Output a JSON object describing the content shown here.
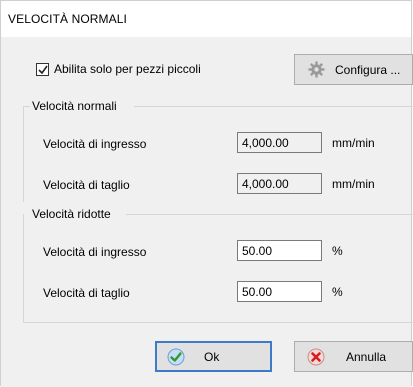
{
  "dialog": {
    "title": "VELOCITÀ NORMALI",
    "enable_checkbox": {
      "label": "Abilita solo per pezzi piccoli",
      "checked": true
    },
    "configure_button": {
      "label": "Configura ...",
      "icon": "gear-icon"
    },
    "normal_group": {
      "title": "Velocità normali",
      "rows": [
        {
          "label": "Velocità di ingresso",
          "value": "4,000.00",
          "unit": "mm/min"
        },
        {
          "label": "Velocità di taglio",
          "value": "4,000.00",
          "unit": "mm/min"
        }
      ]
    },
    "reduced_group": {
      "title": "Velocità ridotte",
      "rows": [
        {
          "label": "Velocità di ingresso",
          "value": "50.00",
          "unit": "%"
        },
        {
          "label": "Velocità di taglio",
          "value": "50.00",
          "unit": "%"
        }
      ]
    },
    "ok_button": {
      "label": "Ok",
      "icon": "check-icon"
    },
    "cancel_button": {
      "label": "Annulla",
      "icon": "cancel-x-icon"
    }
  }
}
